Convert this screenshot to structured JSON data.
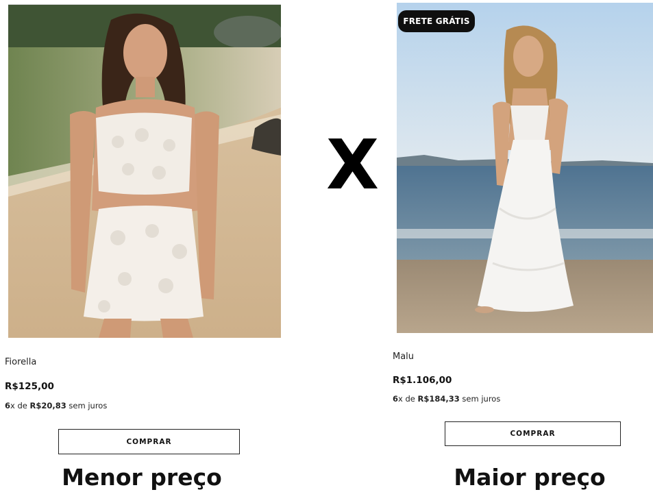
{
  "left_product": {
    "name": "Fiorella",
    "price": "R$125,00",
    "installments": {
      "count": "6",
      "times": "x de",
      "amount": "R$20,83",
      "suffix": "sem juros"
    },
    "buy_label": "COMPRAR",
    "caption": "Menor preço"
  },
  "right_product": {
    "badge": "FRETE GRÁTIS",
    "name": "Malu",
    "price": "R$1.106,00",
    "installments": {
      "count": "6",
      "times": "x de",
      "amount": "R$184,33",
      "suffix": "sem juros"
    },
    "buy_label": "COMPRAR",
    "caption": "Maior preço"
  },
  "versus": "X"
}
